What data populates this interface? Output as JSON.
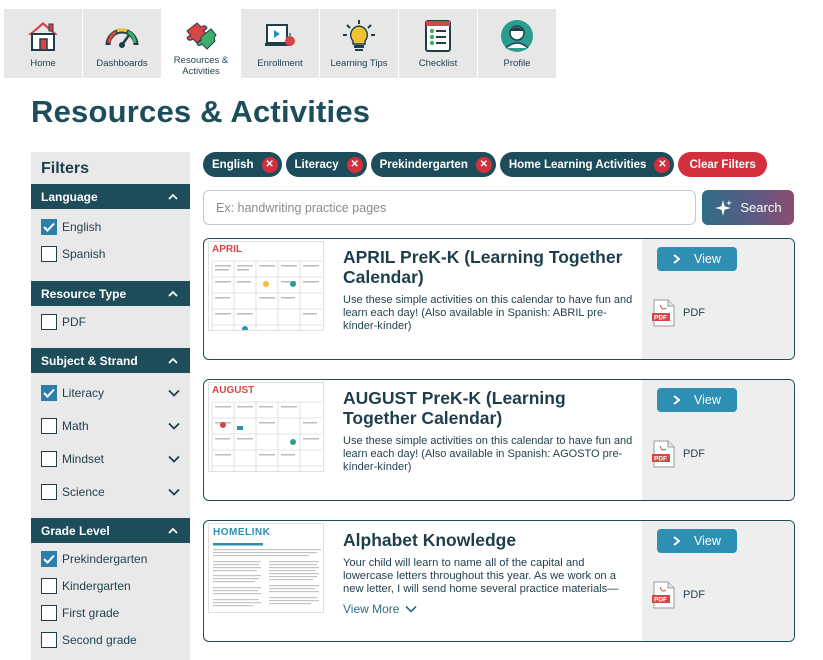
{
  "nav": {
    "tabs": [
      {
        "label": "Home",
        "icon": "house-icon"
      },
      {
        "label": "Dashboards",
        "icon": "gauge-icon"
      },
      {
        "label": "Resources & Activities",
        "icon": "puzzle-icon"
      },
      {
        "label": "Enrollment",
        "icon": "laptop-apple-icon"
      },
      {
        "label": "Learning Tips",
        "icon": "lightbulb-icon"
      },
      {
        "label": "Checklist",
        "icon": "checklist-icon"
      },
      {
        "label": "Profile",
        "icon": "profile-icon"
      }
    ],
    "active_index": 2
  },
  "page_title": "Resources & Activities",
  "filters": {
    "title": "Filters",
    "sections": [
      {
        "title": "Language",
        "items": [
          {
            "label": "English",
            "checked": true
          },
          {
            "label": "Spanish",
            "checked": false
          }
        ]
      },
      {
        "title": "Resource Type",
        "items": [
          {
            "label": "PDF",
            "checked": false
          }
        ]
      },
      {
        "title": "Subject & Strand",
        "items": [
          {
            "label": "Literacy",
            "checked": true
          },
          {
            "label": "Math",
            "checked": false
          },
          {
            "label": "Mindset",
            "checked": false
          },
          {
            "label": "Science",
            "checked": false
          }
        ]
      },
      {
        "title": "Grade Level",
        "items": [
          {
            "label": "Prekindergarten",
            "checked": true
          },
          {
            "label": "Kindergarten",
            "checked": false
          },
          {
            "label": "First grade",
            "checked": false
          },
          {
            "label": "Second grade",
            "checked": false
          }
        ]
      }
    ]
  },
  "chips": [
    "English",
    "Literacy",
    "Prekindergarten",
    "Home Learning Activities"
  ],
  "clear_filters_label": "Clear Filters",
  "search": {
    "placeholder": "Ex: handwriting practice pages",
    "value": "",
    "button_label": "Search"
  },
  "resources": [
    {
      "title": "APRIL PreK-K (Learning Together Calendar)",
      "description": "Use these simple activities on this calendar to have fun and learn each day! (Also available in Spanish: ABRIL pre-kínder-kínder)",
      "view_label": "View",
      "file_label": "PDF",
      "thumb_heading": "APRIL"
    },
    {
      "title": "AUGUST PreK-K (Learning Together Calendar)",
      "description": "Use these simple activities on this calendar to have fun and learn each day! (Also available in Spanish: AGOSTO pre-kínder-kínder)",
      "view_label": "View",
      "file_label": "PDF",
      "thumb_heading": "AUGUST"
    },
    {
      "title": "Alphabet Knowledge",
      "description": "Your child will learn to name all of the capital and lowercase letters throughout this year. As we work on a new letter, I will send home several practice materials—",
      "view_more_label": "View More",
      "view_label": "View",
      "file_label": "PDF",
      "thumb_heading": "HOMELINK"
    }
  ],
  "colors": {
    "brand": "#1d4d5a",
    "accent": "#2d8fb3",
    "danger": "#d32f3c"
  }
}
